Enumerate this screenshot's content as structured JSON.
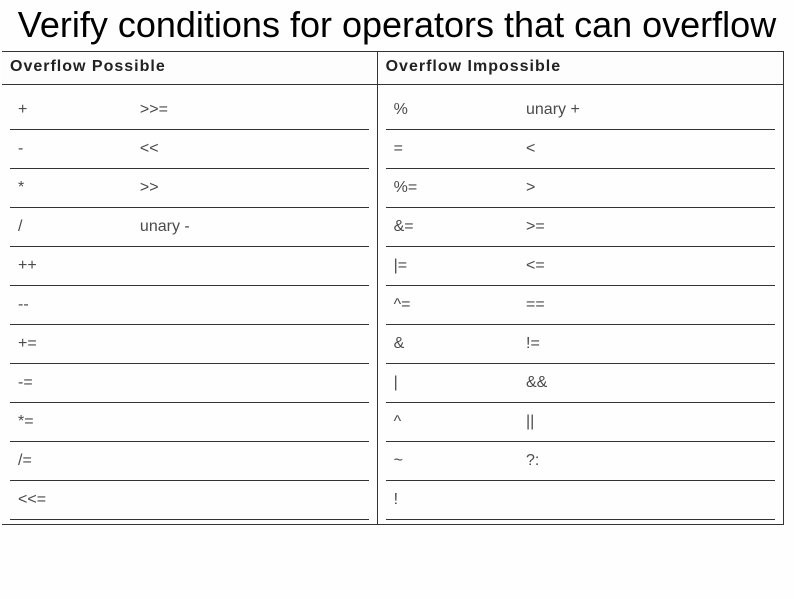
{
  "title": "Verify conditions for operators that can overflow",
  "headers": {
    "possible": "Overflow Possible",
    "impossible": "Overflow Impossible"
  },
  "possible": [
    {
      "c1": "+",
      "c2": ">>="
    },
    {
      "c1": "-",
      "c2": "<<"
    },
    {
      "c1": "*",
      "c2": ">>"
    },
    {
      "c1": "/",
      "c2": "unary -"
    },
    {
      "c1": "++",
      "c2": ""
    },
    {
      "c1": "--",
      "c2": ""
    },
    {
      "c1": "+=",
      "c2": ""
    },
    {
      "c1": "-=",
      "c2": ""
    },
    {
      "c1": "*=",
      "c2": ""
    },
    {
      "c1": "/=",
      "c2": ""
    },
    {
      "c1": "<<=",
      "c2": ""
    }
  ],
  "impossible": [
    {
      "c1": "%",
      "c2": "unary +"
    },
    {
      "c1": "=",
      "c2": "<"
    },
    {
      "c1": "%=",
      "c2": ">"
    },
    {
      "c1": "&=",
      "c2": ">="
    },
    {
      "c1": "|=",
      "c2": "<="
    },
    {
      "c1": "^=",
      "c2": "=="
    },
    {
      "c1": "&",
      "c2": "!="
    },
    {
      "c1": "|",
      "c2": "&&"
    },
    {
      "c1": "^",
      "c2": "||"
    },
    {
      "c1": "~",
      "c2": "?:"
    },
    {
      "c1": "!",
      "c2": ""
    }
  ]
}
